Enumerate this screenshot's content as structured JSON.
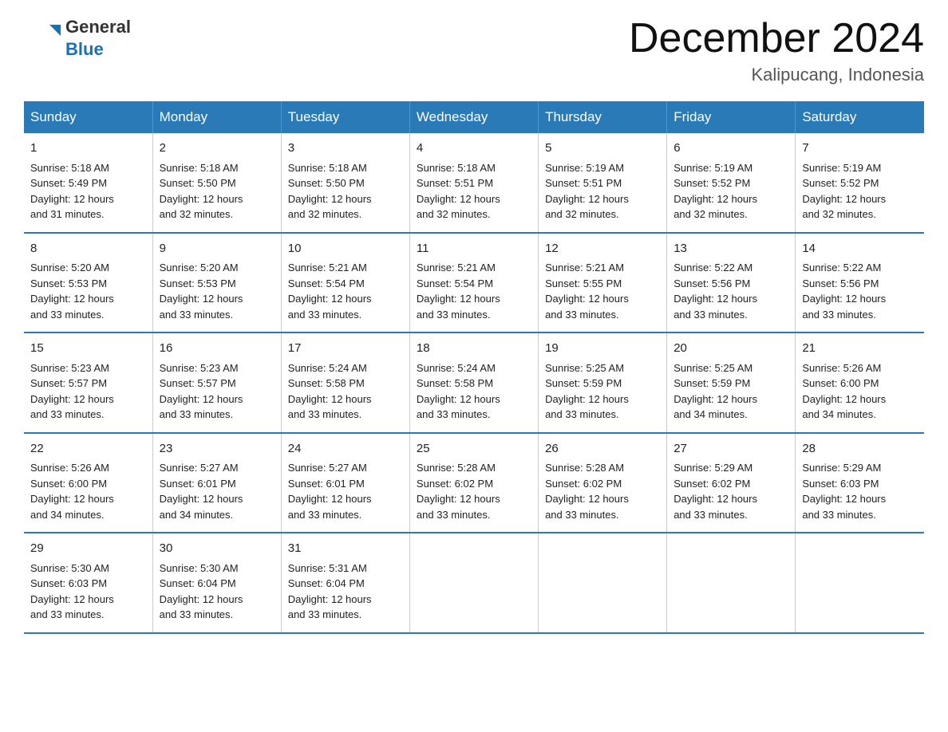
{
  "logo": {
    "line1": "General",
    "line2": "Blue"
  },
  "title": "December 2024",
  "location": "Kalipucang, Indonesia",
  "days_of_week": [
    "Sunday",
    "Monday",
    "Tuesday",
    "Wednesday",
    "Thursday",
    "Friday",
    "Saturday"
  ],
  "weeks": [
    [
      {
        "day": "1",
        "sunrise": "5:18 AM",
        "sunset": "5:49 PM",
        "daylight": "12 hours and 31 minutes."
      },
      {
        "day": "2",
        "sunrise": "5:18 AM",
        "sunset": "5:50 PM",
        "daylight": "12 hours and 32 minutes."
      },
      {
        "day": "3",
        "sunrise": "5:18 AM",
        "sunset": "5:50 PM",
        "daylight": "12 hours and 32 minutes."
      },
      {
        "day": "4",
        "sunrise": "5:18 AM",
        "sunset": "5:51 PM",
        "daylight": "12 hours and 32 minutes."
      },
      {
        "day": "5",
        "sunrise": "5:19 AM",
        "sunset": "5:51 PM",
        "daylight": "12 hours and 32 minutes."
      },
      {
        "day": "6",
        "sunrise": "5:19 AM",
        "sunset": "5:52 PM",
        "daylight": "12 hours and 32 minutes."
      },
      {
        "day": "7",
        "sunrise": "5:19 AM",
        "sunset": "5:52 PM",
        "daylight": "12 hours and 32 minutes."
      }
    ],
    [
      {
        "day": "8",
        "sunrise": "5:20 AM",
        "sunset": "5:53 PM",
        "daylight": "12 hours and 33 minutes."
      },
      {
        "day": "9",
        "sunrise": "5:20 AM",
        "sunset": "5:53 PM",
        "daylight": "12 hours and 33 minutes."
      },
      {
        "day": "10",
        "sunrise": "5:21 AM",
        "sunset": "5:54 PM",
        "daylight": "12 hours and 33 minutes."
      },
      {
        "day": "11",
        "sunrise": "5:21 AM",
        "sunset": "5:54 PM",
        "daylight": "12 hours and 33 minutes."
      },
      {
        "day": "12",
        "sunrise": "5:21 AM",
        "sunset": "5:55 PM",
        "daylight": "12 hours and 33 minutes."
      },
      {
        "day": "13",
        "sunrise": "5:22 AM",
        "sunset": "5:56 PM",
        "daylight": "12 hours and 33 minutes."
      },
      {
        "day": "14",
        "sunrise": "5:22 AM",
        "sunset": "5:56 PM",
        "daylight": "12 hours and 33 minutes."
      }
    ],
    [
      {
        "day": "15",
        "sunrise": "5:23 AM",
        "sunset": "5:57 PM",
        "daylight": "12 hours and 33 minutes."
      },
      {
        "day": "16",
        "sunrise": "5:23 AM",
        "sunset": "5:57 PM",
        "daylight": "12 hours and 33 minutes."
      },
      {
        "day": "17",
        "sunrise": "5:24 AM",
        "sunset": "5:58 PM",
        "daylight": "12 hours and 33 minutes."
      },
      {
        "day": "18",
        "sunrise": "5:24 AM",
        "sunset": "5:58 PM",
        "daylight": "12 hours and 33 minutes."
      },
      {
        "day": "19",
        "sunrise": "5:25 AM",
        "sunset": "5:59 PM",
        "daylight": "12 hours and 33 minutes."
      },
      {
        "day": "20",
        "sunrise": "5:25 AM",
        "sunset": "5:59 PM",
        "daylight": "12 hours and 34 minutes."
      },
      {
        "day": "21",
        "sunrise": "5:26 AM",
        "sunset": "6:00 PM",
        "daylight": "12 hours and 34 minutes."
      }
    ],
    [
      {
        "day": "22",
        "sunrise": "5:26 AM",
        "sunset": "6:00 PM",
        "daylight": "12 hours and 34 minutes."
      },
      {
        "day": "23",
        "sunrise": "5:27 AM",
        "sunset": "6:01 PM",
        "daylight": "12 hours and 34 minutes."
      },
      {
        "day": "24",
        "sunrise": "5:27 AM",
        "sunset": "6:01 PM",
        "daylight": "12 hours and 33 minutes."
      },
      {
        "day": "25",
        "sunrise": "5:28 AM",
        "sunset": "6:02 PM",
        "daylight": "12 hours and 33 minutes."
      },
      {
        "day": "26",
        "sunrise": "5:28 AM",
        "sunset": "6:02 PM",
        "daylight": "12 hours and 33 minutes."
      },
      {
        "day": "27",
        "sunrise": "5:29 AM",
        "sunset": "6:02 PM",
        "daylight": "12 hours and 33 minutes."
      },
      {
        "day": "28",
        "sunrise": "5:29 AM",
        "sunset": "6:03 PM",
        "daylight": "12 hours and 33 minutes."
      }
    ],
    [
      {
        "day": "29",
        "sunrise": "5:30 AM",
        "sunset": "6:03 PM",
        "daylight": "12 hours and 33 minutes."
      },
      {
        "day": "30",
        "sunrise": "5:30 AM",
        "sunset": "6:04 PM",
        "daylight": "12 hours and 33 minutes."
      },
      {
        "day": "31",
        "sunrise": "5:31 AM",
        "sunset": "6:04 PM",
        "daylight": "12 hours and 33 minutes."
      },
      null,
      null,
      null,
      null
    ]
  ],
  "labels": {
    "sunrise": "Sunrise:",
    "sunset": "Sunset:",
    "daylight": "Daylight:"
  }
}
